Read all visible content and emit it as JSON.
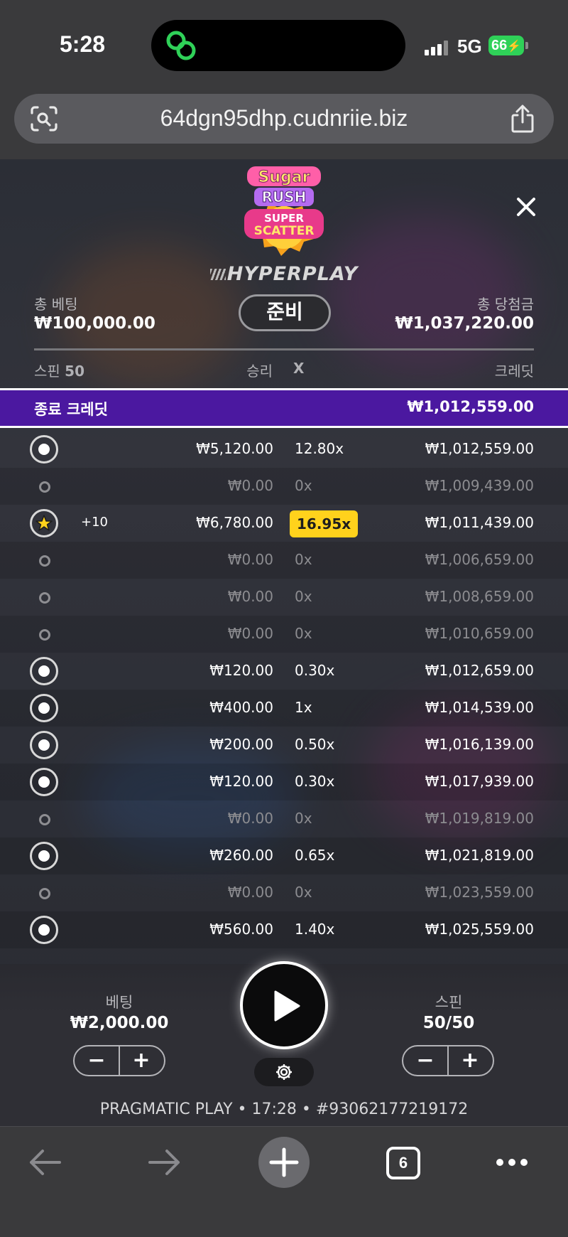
{
  "status_bar": {
    "time": "5:28",
    "network": "5G",
    "battery": "66"
  },
  "browser": {
    "url": "64dgn95dhp.cudnriie.biz",
    "tab_count": "6"
  },
  "game": {
    "brand": "HYPERPLAY",
    "logo_text": "Sugar Rush Super Scatter",
    "total_bet_label": "총 베팅",
    "total_bet_value": "₩100,000.00",
    "ready_button": "준비",
    "total_win_label": "총 당첨금",
    "total_win_value": "₩1,037,220.00",
    "columns": {
      "spin": "스핀",
      "spin_count": "50",
      "win": "승리",
      "mult": "X",
      "credit": "크레딧"
    },
    "final_credit": {
      "label": "종료 크레딧",
      "value": "₩1,012,559.00"
    },
    "rows": [
      {
        "type": "win",
        "extra": "",
        "win": "₩5,120.00",
        "mult": "12.80x",
        "credit": "₩1,012,559.00"
      },
      {
        "type": "none",
        "extra": "",
        "win": "₩0.00",
        "mult": "0x",
        "credit": "₩1,009,439.00"
      },
      {
        "type": "bonus",
        "extra": "+10",
        "win": "₩6,780.00",
        "mult": "16.95x",
        "credit": "₩1,011,439.00"
      },
      {
        "type": "none",
        "extra": "",
        "win": "₩0.00",
        "mult": "0x",
        "credit": "₩1,006,659.00"
      },
      {
        "type": "none",
        "extra": "",
        "win": "₩0.00",
        "mult": "0x",
        "credit": "₩1,008,659.00"
      },
      {
        "type": "none",
        "extra": "",
        "win": "₩0.00",
        "mult": "0x",
        "credit": "₩1,010,659.00"
      },
      {
        "type": "win",
        "extra": "",
        "win": "₩120.00",
        "mult": "0.30x",
        "credit": "₩1,012,659.00"
      },
      {
        "type": "win",
        "extra": "",
        "win": "₩400.00",
        "mult": "1x",
        "credit": "₩1,014,539.00"
      },
      {
        "type": "win",
        "extra": "",
        "win": "₩200.00",
        "mult": "0.50x",
        "credit": "₩1,016,139.00"
      },
      {
        "type": "win",
        "extra": "",
        "win": "₩120.00",
        "mult": "0.30x",
        "credit": "₩1,017,939.00"
      },
      {
        "type": "none",
        "extra": "",
        "win": "₩0.00",
        "mult": "0x",
        "credit": "₩1,019,819.00"
      },
      {
        "type": "win",
        "extra": "",
        "win": "₩260.00",
        "mult": "0.65x",
        "credit": "₩1,021,819.00"
      },
      {
        "type": "none",
        "extra": "",
        "win": "₩0.00",
        "mult": "0x",
        "credit": "₩1,023,559.00"
      },
      {
        "type": "win",
        "extra": "",
        "win": "₩560.00",
        "mult": "1.40x",
        "credit": "₩1,025,559.00"
      }
    ],
    "controls": {
      "bet_label": "베팅",
      "bet_value": "₩2,000.00",
      "spins_label": "스핀",
      "spins_value": "50/50",
      "minus": "−",
      "plus": "+"
    },
    "footer": "PRAGMATIC PLAY • 17:28 • #93062177219172",
    "highlight_color": "#ffd21c",
    "final_bar_color": "#4b18a0"
  }
}
